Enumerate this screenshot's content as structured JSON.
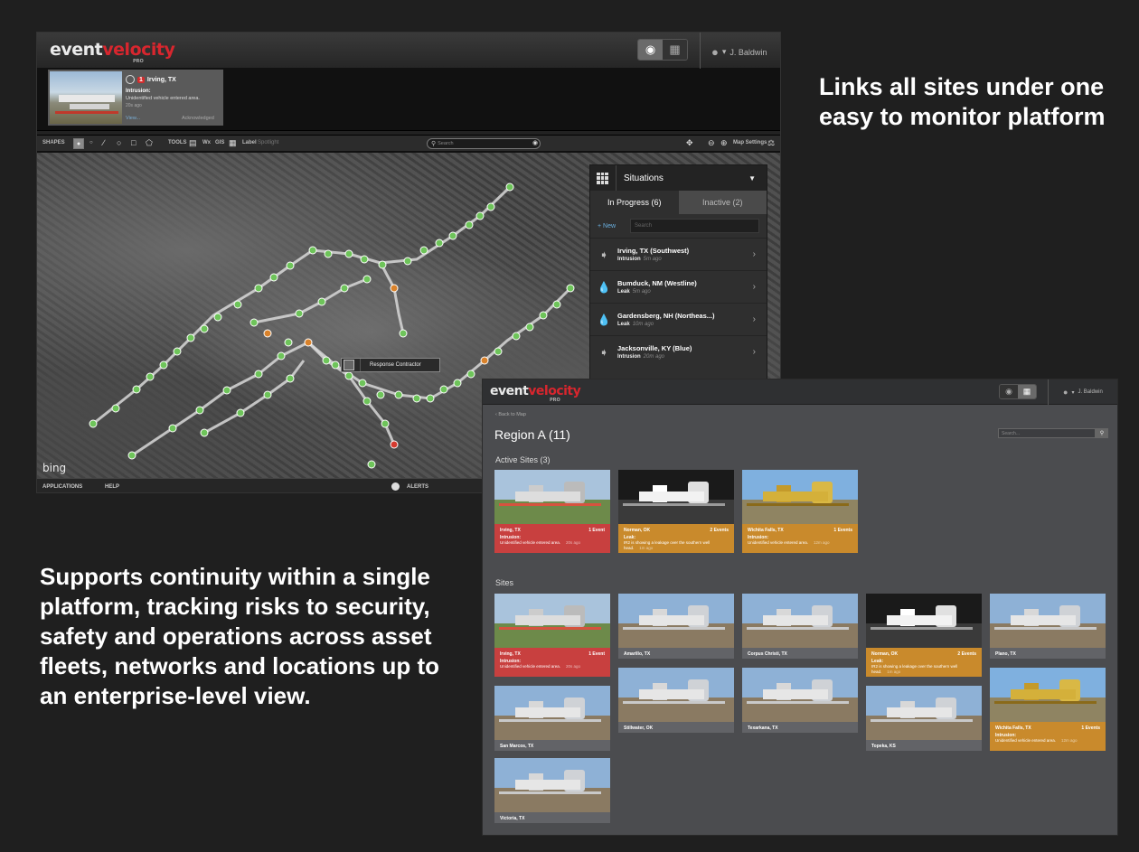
{
  "marketing": {
    "headline_top": "Links all sites under one easy to monitor platform",
    "headline_bottom": "Supports continuity within a single platform, tracking risks to security, safety and operations across asset fleets, networks and locations up to an enterprise-level view."
  },
  "brand": {
    "logo_event": "event",
    "logo_velocity": "velocity",
    "logo_pro": "PRO",
    "accent": "#d8262e"
  },
  "app1": {
    "user": "J. Baldwin",
    "alert": {
      "count": "1",
      "city": "Irving, TX",
      "type": "Intrusion:",
      "desc": "Unidentified vehicle entered area.",
      "ago": "20s ago",
      "view": "View...",
      "ack": "Acknowledged"
    },
    "toolbar": {
      "shapes": "SHAPES",
      "tools": "TOOLS",
      "wx": "Wx",
      "gis": "GIS",
      "label": "Label",
      "label_sub": "Spotlight",
      "search_placeholder": "Search",
      "map_settings": "Map Settings"
    },
    "map": {
      "response_contractor": "Response Contractor",
      "bing": "bing"
    },
    "situations": {
      "title": "Situations",
      "tab_active": "In Progress (6)",
      "tab_inactive": "Inactive (2)",
      "new": "+ New",
      "search_placeholder": "Search",
      "items": [
        {
          "name": "Irving, TX (Southwest)",
          "type": "Intrusion",
          "ago": "5m ago",
          "icon": "runner-icon"
        },
        {
          "name": "Bumduck, NM (Westline)",
          "type": "Leak",
          "ago": "5m ago",
          "icon": "drop-icon"
        },
        {
          "name": "Gardensberg, NH (Northeas...)",
          "type": "Leak",
          "ago": "10m ago",
          "icon": "drop-icon"
        },
        {
          "name": "Jacksonville, KY (Blue)",
          "type": "Intrusion",
          "ago": "20m ago",
          "icon": "runner-icon"
        }
      ]
    },
    "bottom": {
      "applications": "APPLICATIONS",
      "help": "HELP",
      "alerts": "ALERTS"
    }
  },
  "app2": {
    "user": "J. Baldwin",
    "back": "‹ Back to Map",
    "region_title": "Region A (11)",
    "search_placeholder": "Search...",
    "active_title": "Active Sites (3)",
    "sites_title": "Sites",
    "active_sites": [
      {
        "name": "Irving, TX",
        "events": "1 Event",
        "type": "Intrusion:",
        "desc": "Unidentified vehicle entered area.",
        "ago": "20s ago",
        "status": "red"
      },
      {
        "name": "Norman, OK",
        "events": "2 Events",
        "type": "Leak:",
        "desc": "IR2 is showing a leakage over the southern well head.",
        "ago": "1m ago",
        "status": "orange"
      },
      {
        "name": "Wichita Falls, TX",
        "events": "1 Events",
        "type": "Intrusion:",
        "desc": "Unidentified vehicle entered area.",
        "ago": "12m ago",
        "status": "orange"
      }
    ],
    "sites": [
      {
        "name": "Irving, TX",
        "events": "1 Event",
        "type": "Intrusion:",
        "desc": "Unidentified vehicle entered area.",
        "ago": "20s ago",
        "status": "red"
      },
      {
        "name": "Amarillo, TX",
        "status": "none"
      },
      {
        "name": "Corpus Christi, TX",
        "status": "none"
      },
      {
        "name": "Norman, OK",
        "events": "2 Events",
        "type": "Leak:",
        "desc": "IR2 is showing a leakage over the southern well head.",
        "ago": "1m ago",
        "status": "orange"
      },
      {
        "name": "Plano, TX",
        "status": "none"
      },
      {
        "name": "San Marcos, TX",
        "status": "none"
      },
      {
        "name": "Stillwater, OK",
        "status": "none"
      },
      {
        "name": "Texarkana, TX",
        "status": "none"
      },
      {
        "name": "Topeka, KS",
        "status": "none"
      },
      {
        "name": "Wichita Falls, TX",
        "events": "1 Events",
        "type": "Intrusion:",
        "desc": "Unidentified vehicle entered area.",
        "ago": "12m ago",
        "status": "orange"
      },
      {
        "name": "Victoria, TX",
        "status": "none"
      }
    ]
  },
  "colors": {
    "alert_red": "#c8403f",
    "warn_orange": "#c98a2c",
    "node_green": "#6ec45a",
    "node_orange": "#d9822b",
    "node_red": "#d43a2f"
  }
}
